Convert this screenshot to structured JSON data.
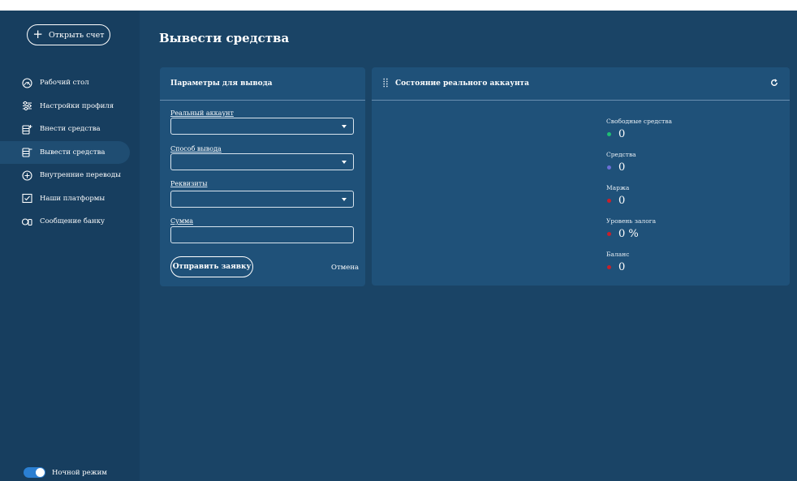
{
  "sidebar": {
    "open_account_label": "Открыть счет",
    "items": [
      {
        "label": "Рабочий стол",
        "icon": "dashboard-icon"
      },
      {
        "label": "Настройки профиля",
        "icon": "sliders-icon"
      },
      {
        "label": "Внести средства",
        "icon": "wallet-in-icon"
      },
      {
        "label": "Вывести средства",
        "icon": "wallet-out-icon",
        "active": true
      },
      {
        "label": "Внутренние переводы",
        "icon": "transfer-icon"
      },
      {
        "label": "Наши платформы",
        "icon": "platform-icon"
      },
      {
        "label": "Сообщение банку",
        "icon": "message-icon"
      }
    ],
    "night_mode_label": "Ночной режим",
    "night_mode_on": true
  },
  "main": {
    "title": "Вывести средства",
    "withdraw_form": {
      "title": "Параметры для вывода",
      "fields": [
        {
          "label": "Реальный аккаунт",
          "value": "",
          "type": "select"
        },
        {
          "label": "Способ вывода",
          "value": "",
          "type": "select"
        },
        {
          "label": "Реквизиты",
          "value": "",
          "type": "select"
        },
        {
          "label": "Сумма",
          "value": "",
          "type": "input"
        }
      ],
      "submit_label": "Отправить заявку",
      "cancel_label": "Отмена"
    },
    "account_state": {
      "title": "Состояние реального аккаунта",
      "stats": [
        {
          "label": "Свободные средства",
          "value": "0",
          "color": "#1fbf73"
        },
        {
          "label": "Средства",
          "value": "0",
          "color": "#6b6fd6"
        },
        {
          "label": "Маржа",
          "value": "0",
          "color": "#c8202a"
        },
        {
          "label": "Уровень залога",
          "value": "0 %",
          "color": "#c8202a"
        },
        {
          "label": "Баланс",
          "value": "0",
          "color": "#c8202a"
        }
      ]
    }
  },
  "colors": {
    "background": "#1a4466",
    "sidebar": "#173e5f",
    "card": "#1f5179",
    "toggle": "#2b7fd2"
  }
}
